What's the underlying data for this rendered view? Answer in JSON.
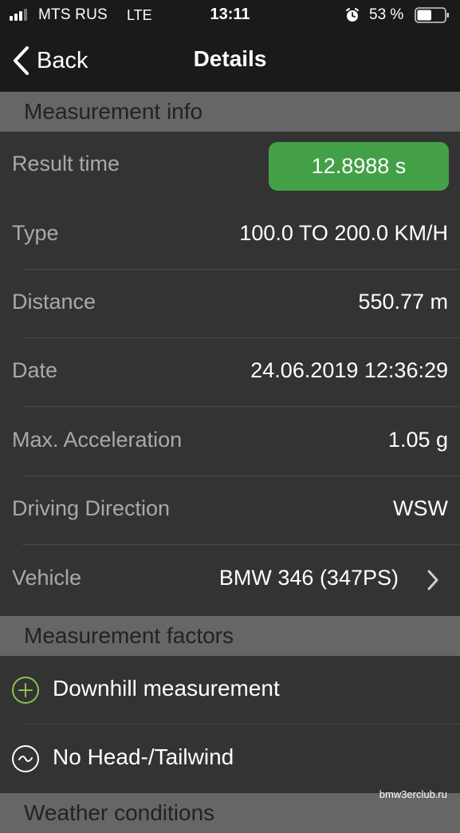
{
  "status_bar": {
    "carrier": "MTS RUS",
    "network": "LTE",
    "time": "13:11",
    "battery_percent": "53 %",
    "battery_level": 0.53,
    "signal_bars_filled": 3,
    "signal_bars_total": 4
  },
  "nav": {
    "back_label": "Back",
    "title": "Details"
  },
  "sections": {
    "measurement_info": "Measurement info",
    "measurement_factors": "Measurement factors",
    "weather_conditions": "Weather conditions"
  },
  "measurement": {
    "result_time_label": "Result time",
    "result_time_value": "12.8988 s",
    "type_label": "Type",
    "type_value": "100.0 TO 200.0 KM/H",
    "distance_label": "Distance",
    "distance_value": "550.77 m",
    "date_label": "Date",
    "date_value": "24.06.2019 12:36:29",
    "max_accel_label": "Max. Acceleration",
    "max_accel_value": "1.05 g",
    "direction_label": "Driving Direction",
    "direction_value": "WSW",
    "vehicle_label": "Vehicle",
    "vehicle_value": "BMW 346 (347PS)"
  },
  "factors": {
    "downhill": "Downhill measurement",
    "wind": "No Head-/Tailwind"
  },
  "icons": {
    "alarm": "alarm-clock-icon",
    "battery": "battery-icon",
    "back": "chevron-left-icon",
    "vehicle_chevron": "chevron-right-icon",
    "downhill": "plus-circle-icon",
    "wind": "tilde-circle-icon"
  },
  "colors": {
    "result_pill": "#43a047",
    "downhill_icon": "#8bc34a",
    "section_header": "#666666",
    "background": "#333333"
  },
  "watermark": "bmw3erclub.ru"
}
